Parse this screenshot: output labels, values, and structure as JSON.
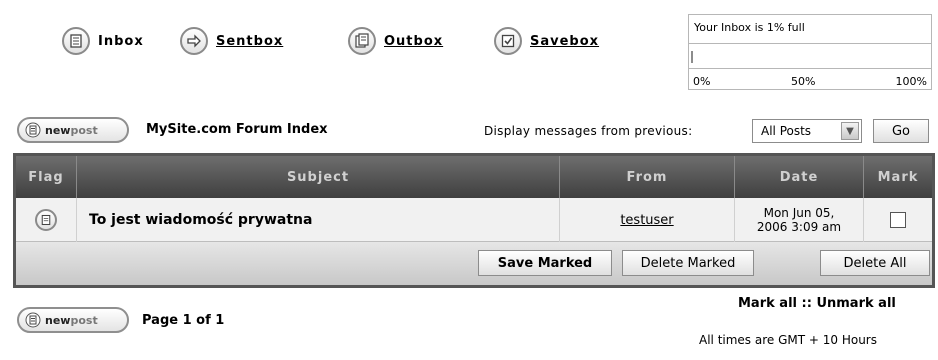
{
  "boxes": [
    {
      "label": "Inbox",
      "icon": "inbox-icon",
      "active": true
    },
    {
      "label": "Sentbox",
      "icon": "sentbox-arrow-icon",
      "active": false
    },
    {
      "label": "Outbox",
      "icon": "outbox-icon",
      "active": false
    },
    {
      "label": "Savebox",
      "icon": "savebox-check-icon",
      "active": false
    }
  ],
  "inbox_meter": {
    "title": "Your Inbox is 1% full",
    "percent_full": 1,
    "ticks": [
      "0%",
      "50%",
      "100%"
    ]
  },
  "newpost_label": {
    "new": "new",
    "post": "post"
  },
  "breadcrumb": "MySite.com Forum Index",
  "filter": {
    "label": "Display messages from previous:",
    "selected": "All Posts",
    "go_label": "Go"
  },
  "table": {
    "headers": {
      "flag": "Flag",
      "subject": "Subject",
      "from": "From",
      "date": "Date",
      "mark": "Mark"
    },
    "rows": [
      {
        "subject": "To jest wiadomość prywatna",
        "from": "testuser",
        "date_line1": "Mon Jun 05,",
        "date_line2": "2006 3:09 am",
        "marked": false
      }
    ],
    "actions": {
      "save_marked": "Save Marked",
      "delete_marked": "Delete Marked",
      "delete_all": "Delete All"
    }
  },
  "mark_links": {
    "mark_all": "Mark all",
    "separator": "::",
    "unmark_all": "Unmark all"
  },
  "pagination": "Page 1 of 1",
  "timezone": "All times are GMT + 10 Hours",
  "colors": {
    "header_dark": "#4a4a4a",
    "row_bg": "#f1f1f1",
    "border": "#555555"
  }
}
